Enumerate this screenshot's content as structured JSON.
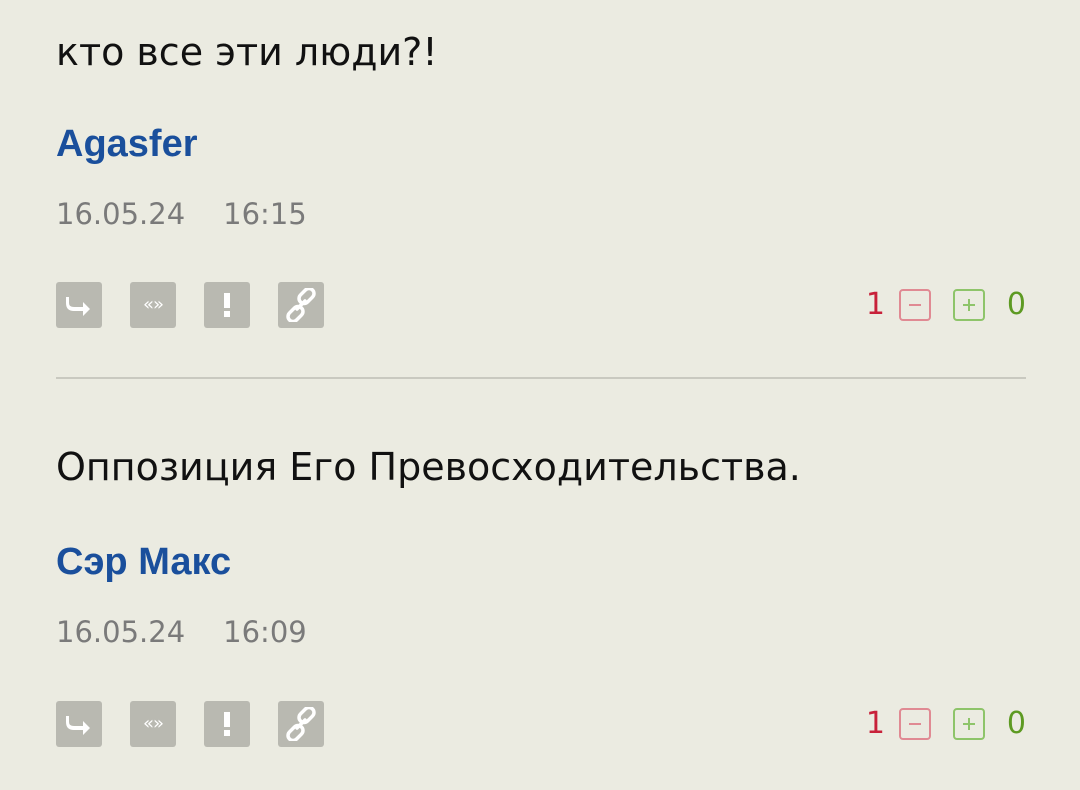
{
  "comments": [
    {
      "text": "кто все эти люди?!",
      "author": "Agasfer",
      "date": "16.05.24",
      "time": "16:15",
      "rating_negative": "1",
      "rating_positive": "0"
    },
    {
      "text": "Оппозиция Его Превосходительства.",
      "author": "Сэр Макс",
      "date": "16.05.24",
      "time": "16:09",
      "rating_negative": "1",
      "rating_positive": "0"
    }
  ],
  "action_icons": [
    "reply-icon",
    "quote-icon",
    "report-icon",
    "link-icon"
  ],
  "colors": {
    "background": "#ebebe1",
    "author": "#1a4f9c",
    "negative": "#c8213a",
    "positive": "#5d9a22",
    "icon_button": "#b9b9b1"
  }
}
